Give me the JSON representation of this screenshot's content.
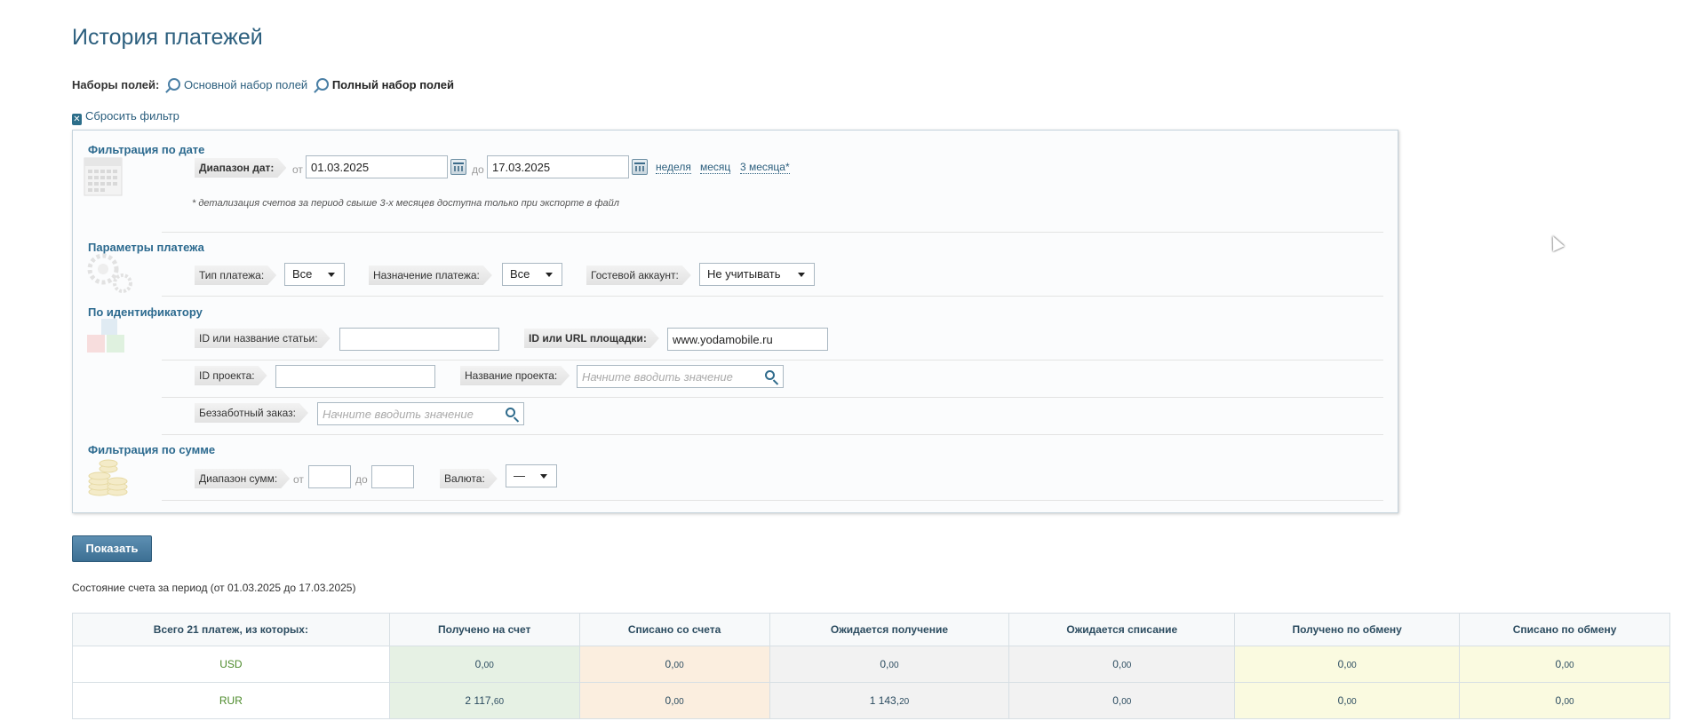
{
  "page_title": "История платежей",
  "fieldsets": {
    "label": "Наборы полей:",
    "basic": "Основной набор полей",
    "full": "Полный набор полей"
  },
  "reset_filter": "Сбросить фильтр",
  "date_filter": {
    "title": "Фильтрация по дате",
    "range_label": "Диапазон дат:",
    "from_label": "от",
    "from_value": "01.03.2025",
    "to_label": "до",
    "to_value": "17.03.2025",
    "quick": [
      "неделя",
      "месяц",
      "3 месяца*"
    ],
    "note": "* детализация счетов за период свыше 3-х месяцев доступна только при экспорте в файл"
  },
  "payment_params": {
    "title": "Параметры платежа",
    "type_label": "Тип платежа:",
    "type_value": "Все",
    "purpose_label": "Назначение платежа:",
    "purpose_value": "Все",
    "guest_label": "Гостевой аккаунт:",
    "guest_value": "Не учитывать"
  },
  "by_id": {
    "title": "По идентификатору",
    "article_label": "ID или название статьи:",
    "article_value": "",
    "site_label": "ID или URL площадки:",
    "site_value": "www.yodamobile.ru",
    "project_id_label": "ID проекта:",
    "project_id_value": "",
    "project_name_label": "Название проекта:",
    "project_name_placeholder": "Начните вводить значение",
    "order_label": "Беззаботный заказ:",
    "order_placeholder": "Начните вводить значение"
  },
  "sum_filter": {
    "title": "Фильтрация по сумме",
    "range_label": "Диапазон сумм:",
    "from_label": "от",
    "to_label": "до",
    "currency_label": "Валюта:",
    "currency_value": "—"
  },
  "show_button": "Показать",
  "period_text": "Состояние счета за период (от 01.03.2025 до 17.03.2025)",
  "table": {
    "headers": [
      "Всего 21 платеж, из которых:",
      "Получено на счет",
      "Списано со счета",
      "Ожидается получение",
      "Ожидается списание",
      "Получено по обмену",
      "Списано по обмену"
    ],
    "rows": [
      {
        "currency": "USD",
        "cells": [
          [
            "0,",
            "00"
          ],
          [
            "0,",
            "00"
          ],
          [
            "0,",
            "00"
          ],
          [
            "0,",
            "00"
          ],
          [
            "0,",
            "00"
          ],
          [
            "0,",
            "00"
          ]
        ]
      },
      {
        "currency": "RUR",
        "cells": [
          [
            "2 117,",
            "60"
          ],
          [
            "0,",
            "00"
          ],
          [
            "1 143,",
            "20"
          ],
          [
            "0,",
            "00"
          ],
          [
            "0,",
            "00"
          ],
          [
            "0,",
            "00"
          ]
        ]
      }
    ]
  }
}
